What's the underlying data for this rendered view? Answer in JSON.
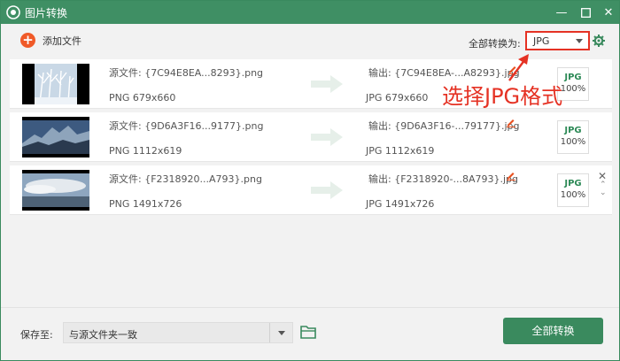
{
  "window": {
    "title": "图片转换"
  },
  "toolbar": {
    "add_label": "添加文件",
    "convert_to_label": "全部转换为:",
    "format_value": "JPG"
  },
  "annotation": {
    "text": "选择JPG格式"
  },
  "files": [
    {
      "source_name": "源文件: {7C94E8EA...8293}.png",
      "source_info": "PNG  679x660",
      "output_name": "输出: {7C94E8EA-...A8293}.jpg",
      "output_info": "JPG  679x660",
      "badge_format": "JPG",
      "badge_percent": "100%"
    },
    {
      "source_name": "源文件: {9D6A3F16...9177}.png",
      "source_info": "PNG  1112x619",
      "output_name": "输出: {9D6A3F16-...79177}.jpg",
      "output_info": "JPG  1112x619",
      "badge_format": "JPG",
      "badge_percent": "100%"
    },
    {
      "source_name": "源文件: {F2318920...A793}.png",
      "source_info": "PNG  1491x726",
      "output_name": "输出: {F2318920-...8A793}.jpg",
      "output_info": "JPG  1491x726",
      "badge_format": "JPG",
      "badge_percent": "100%"
    }
  ],
  "footer": {
    "save_label": "保存至:",
    "save_value": "与源文件夹一致",
    "convert_all_label": "全部转换"
  },
  "colors": {
    "accent": "#3f8f64",
    "highlight": "#e53224",
    "add": "#f05a28"
  }
}
